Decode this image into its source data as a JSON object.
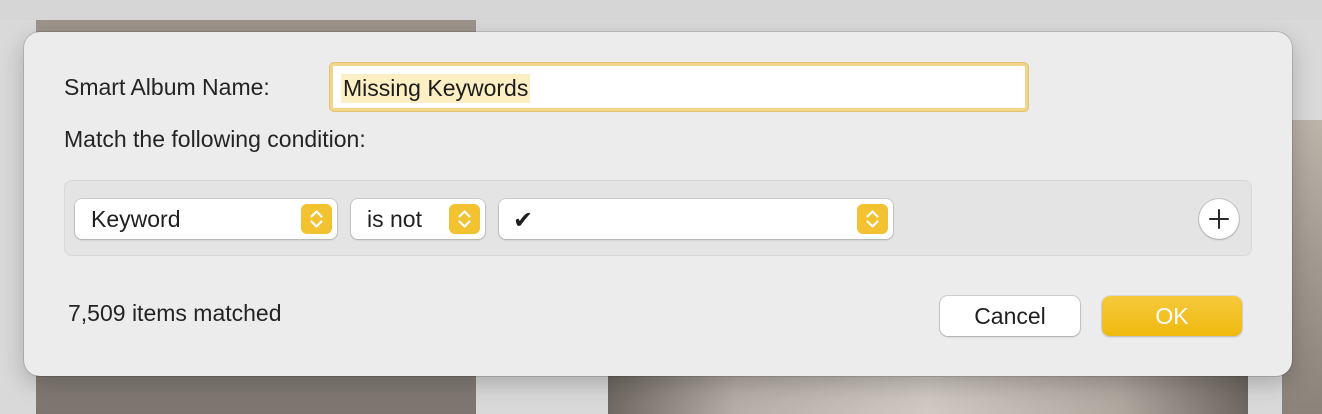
{
  "dialog": {
    "name_label": "Smart Album Name:",
    "name_value": "Missing Keywords",
    "match_label": "Match the following condition:",
    "condition": {
      "field": "Keyword",
      "operator": "is not",
      "value": "✔"
    },
    "items_matched": "7,509 items matched",
    "cancel_label": "Cancel",
    "ok_label": "OK"
  },
  "icons": {
    "stepper": "chevron-up-down-icon",
    "add": "plus-icon"
  },
  "colors": {
    "accent": "#f2c230",
    "field_highlight": "#f2d48a",
    "text_selection": "#fcefc4",
    "sheet_background": "#ececec"
  }
}
